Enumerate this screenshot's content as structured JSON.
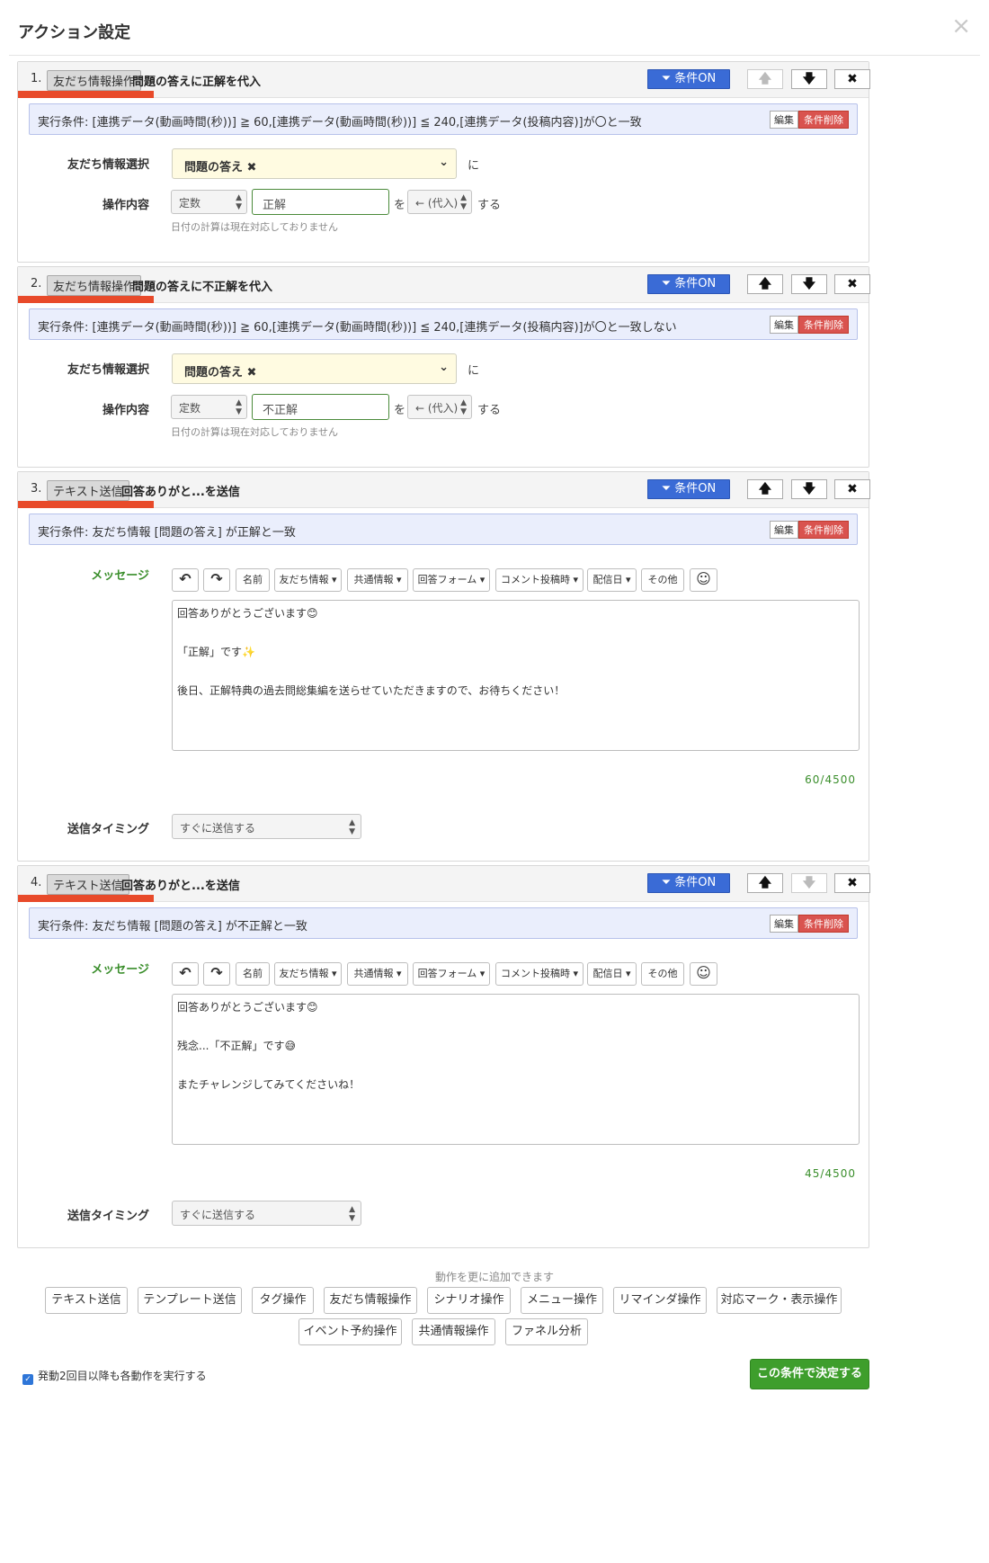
{
  "modal": {
    "title": "アクション設定",
    "close": "×"
  },
  "labels": {
    "cond_on": "条件ON",
    "edit": "編集",
    "cond_delete": "条件削除",
    "friend_select": "友だち情報選択",
    "op_content": "操作内容",
    "ni": "に",
    "wo": "を",
    "suru": "する",
    "date_hint": "日付の計算は現在対応しておりません",
    "message": "メッセージ",
    "timing": "送信タイミング"
  },
  "icons": {
    "up": "🡅",
    "down": "🡇",
    "x": "✖",
    "filter": "⏷",
    "undo": "↶",
    "redo": "↷",
    "emoji": "☺"
  },
  "actions": [
    {
      "num": "1.",
      "type": "友だち情報操作",
      "title": "問題の答えに正解を代入",
      "condition": "実行条件: [連携データ(動画時間(秒))] ≧ 60,[連携データ(動画時間(秒))] ≦ 240,[連携データ(投稿内容)]が〇と一致",
      "friend_field": "問題の答え ✖",
      "op_type": "定数",
      "op_value": "正解",
      "op_mode": "← (代入)"
    },
    {
      "num": "2.",
      "type": "友だち情報操作",
      "title": "問題の答えに不正解を代入",
      "condition": "実行条件: [連携データ(動画時間(秒))] ≧ 60,[連携データ(動画時間(秒))] ≦ 240,[連携データ(投稿内容)]が〇と一致しない",
      "friend_field": "問題の答え ✖",
      "op_type": "定数",
      "op_value": "不正解",
      "op_mode": "← (代入)"
    },
    {
      "num": "3.",
      "type": "テキスト送信",
      "title": "回答ありがと...を送信",
      "condition": "実行条件: 友だち情報 [問題の答え] が正解と一致",
      "message_lines": [
        "回答ありがとうございます😊",
        "「正解」です✨",
        "後日、正解特典の過去問総集編を送らせていただきますので、お待ちください！"
      ],
      "counter": "60/4500",
      "timing": "すぐに送信する"
    },
    {
      "num": "4.",
      "type": "テキスト送信",
      "title": "回答ありがと...を送信",
      "condition": "実行条件: 友だち情報 [問題の答え] が不正解と一致",
      "message_lines": [
        "回答ありがとうございます😊",
        "残念...「不正解」です😅",
        "またチャレンジしてみてくださいね！"
      ],
      "counter": "45/4500",
      "timing": "すぐに送信する"
    }
  ],
  "toolbar": {
    "name": "名前",
    "friend": "友だち情報 ▾",
    "common": "共通情報 ▾",
    "form": "回答フォーム ▾",
    "comment": "コメント投稿時 ▾",
    "date": "配信日 ▾",
    "other": "その他"
  },
  "add": {
    "hint": "動作を更に追加できます",
    "buttons": [
      "テキスト送信",
      "テンプレート送信",
      "タグ操作",
      "友だち情報操作",
      "シナリオ操作",
      "メニュー操作",
      "リマインダ操作",
      "対応マーク・表示操作",
      "イベント予約操作",
      "共通情報操作",
      "ファネル分析"
    ]
  },
  "footer": {
    "repeat_label": "発動2回目以降も各動作を実行する",
    "submit": "この条件で決定する"
  }
}
